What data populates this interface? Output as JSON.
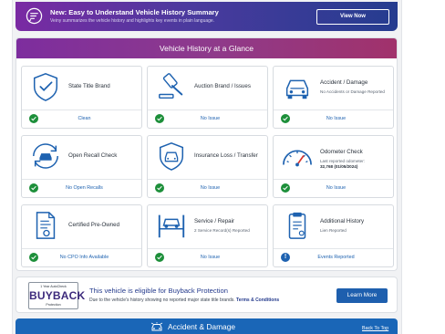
{
  "banner": {
    "title": "New: Easy to Understand Vehicle History Summary",
    "subtitle": "Veiny summarizes the vehicle history and highlights key events in plain language.",
    "button": "View Now"
  },
  "section": {
    "title": "Vehicle History at a Glance"
  },
  "cards": [
    {
      "icon": "shield-check-icon",
      "title": "State Title Brand",
      "detail": "",
      "detail_value": "",
      "status": "Clean",
      "status_kind": "ok"
    },
    {
      "icon": "gavel-icon",
      "title": "Auction Brand / Issues",
      "detail": "",
      "detail_value": "",
      "status": "No Issue",
      "status_kind": "ok"
    },
    {
      "icon": "car-front-icon",
      "title": "Accident / Damage",
      "detail": "No Accidents or Damage Reported",
      "detail_value": "",
      "status": "No Issue",
      "status_kind": "ok"
    },
    {
      "icon": "car-recall-icon",
      "title": "Open Recall Check",
      "detail": "",
      "detail_value": "",
      "status": "No Open Recalls",
      "status_kind": "ok"
    },
    {
      "icon": "shield-car-icon",
      "title": "Insurance Loss / Transfer",
      "detail": "",
      "detail_value": "",
      "status": "No Issue",
      "status_kind": "ok"
    },
    {
      "icon": "odometer-icon",
      "title": "Odometer Check",
      "detail": "Last reported odometer:",
      "detail_value": "32,768 (01/05/2024)",
      "status": "No Issue",
      "status_kind": "ok"
    },
    {
      "icon": "certificate-icon",
      "title": "Certified Pre-Owned",
      "detail": "",
      "detail_value": "",
      "status": "No CPO Info Available",
      "status_kind": "ok"
    },
    {
      "icon": "car-lift-icon",
      "title": "Service / Repair",
      "detail": "2 Service Record(s) Reported",
      "detail_value": "",
      "status": "No Issue",
      "status_kind": "ok"
    },
    {
      "icon": "clipboard-icon",
      "title": "Additional History",
      "detail": "Lien Reported",
      "detail_value": "",
      "status": "Events Reported",
      "status_kind": "alert"
    }
  ],
  "buyback": {
    "logo_top": "1 Year AutoCheck",
    "logo_word": "BUYBACK",
    "logo_bottom": "Protection",
    "title": "This vehicle is eligible for Buyback Protection",
    "text": "Due to the vehicle's history showing no reported major state title brands.",
    "link": "Terms & Conditions",
    "button": "Learn More"
  },
  "accident_section": {
    "title": "Accident & Damage",
    "back_link": "Back To Top"
  },
  "colors": {
    "banner_gradient_start": "#7a2aa3",
    "banner_gradient_end": "#253c8f",
    "section_header": "#8e3a8c",
    "ok_green": "#1d8f3a",
    "link_blue": "#1e62b0",
    "bar_blue": "#1a66b7"
  }
}
